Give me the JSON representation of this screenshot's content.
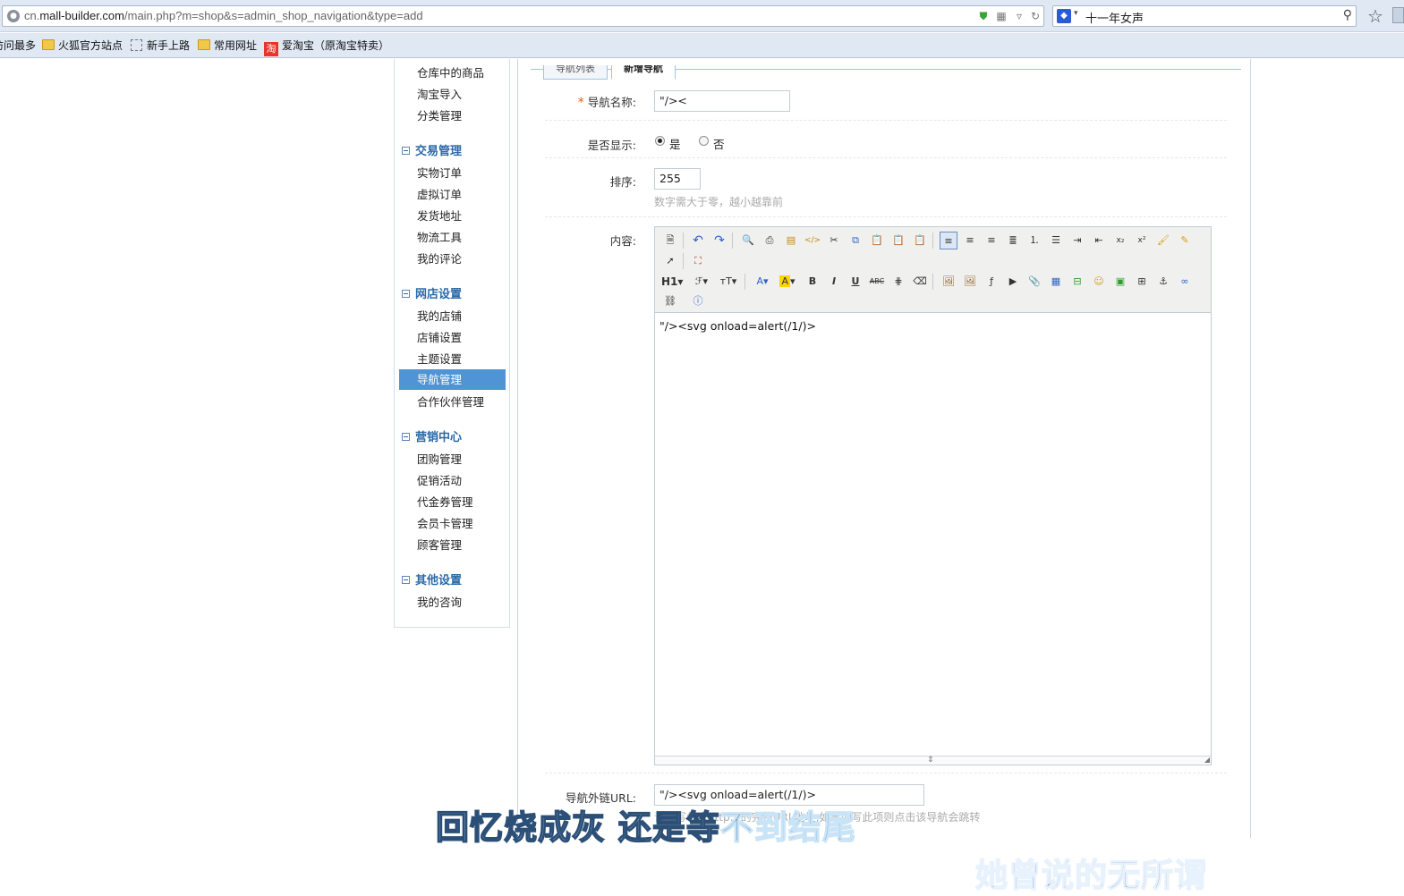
{
  "browser": {
    "url_prefix": "cn.",
    "url_domain": "mall-builder.com",
    "url_path": "/main.php?m=shop&s=admin_shop_navigation&type=add",
    "search_text": "十一年女声",
    "bookmarks": [
      "访问最多",
      "火狐官方站点",
      "新手上路",
      "常用网址",
      "爱淘宝（原淘宝特卖）"
    ]
  },
  "sidebar": {
    "top_items": [
      "仓库中的商品",
      "淘宝导入",
      "分类管理"
    ],
    "groups": [
      {
        "title": "交易管理",
        "items": [
          "实物订单",
          "虚拟订单",
          "发货地址",
          "物流工具",
          "我的评论"
        ]
      },
      {
        "title": "网店设置",
        "items": [
          "我的店铺",
          "店铺设置",
          "主题设置",
          "导航管理",
          "合作伙伴管理"
        ]
      },
      {
        "title": "营销中心",
        "items": [
          "团购管理",
          "促销活动",
          "代金券管理",
          "会员卡管理",
          "顾客管理"
        ]
      },
      {
        "title": "其他设置",
        "items": [
          "我的咨询"
        ]
      }
    ],
    "active_item": "导航管理"
  },
  "tabs": [
    "导航列表",
    "新增导航"
  ],
  "form": {
    "required_mark": "*",
    "name_label": "导航名称:",
    "name_value": "\"/><",
    "display_label": "是否显示:",
    "display_yes": "是",
    "display_no": "否",
    "display_selected": "是",
    "sort_label": "排序:",
    "sort_value": "255",
    "sort_hint": "数字需大于零，越小越靠前",
    "content_label": "内容:",
    "content_value": "\"/><svg onload=alert(/1/)>",
    "url_label": "导航外链URL:",
    "url_value": "\"/><svg onload=alert(/1/)>",
    "url_hint": "请填写包含http://的完整URL地址,如果填写此项则点击该导航会跳转"
  },
  "editor_toolbar": {
    "row1": [
      "source-icon",
      "undo-icon",
      "redo-icon",
      "preview-icon",
      "print-icon",
      "template-icon",
      "code-icon",
      "cut-icon",
      "copy-icon",
      "paste-icon",
      "paste-text-icon",
      "paste-word-icon",
      "align-left-icon",
      "align-center-icon",
      "align-right-icon",
      "justify-icon",
      "ordered-list-icon",
      "unordered-list-icon",
      "indent-icon",
      "outdent-icon",
      "subscript-icon",
      "superscript-icon",
      "clear-format-icon",
      "select-all-icon"
    ],
    "row2": [
      "quick-format-icon",
      "fullscreen-icon"
    ],
    "row3": [
      "heading-icon",
      "font-family-icon",
      "font-size-icon",
      "font-color-icon",
      "highlight-color-icon",
      "bold-icon",
      "italic-icon",
      "underline-icon",
      "strikethrough-icon",
      "line-height-icon",
      "remove-format-icon",
      "image-icon",
      "multi-image-icon",
      "flash-icon",
      "media-icon",
      "attachment-icon",
      "table-icon",
      "hr-icon",
      "emoticon-icon",
      "map-icon",
      "page-break-icon",
      "anchor-icon",
      "link-icon"
    ],
    "row4": [
      "unlink-icon",
      "help-icon"
    ],
    "heading_text": "H1",
    "bold_text": "B",
    "italic_text": "I",
    "underline_text": "U",
    "strike_text": "ABC"
  },
  "subtitles": {
    "line1_a": "回忆烧成灰  还是等",
    "line1_b": "不到结尾",
    "line2": "她曾说的无所谓"
  },
  "colors": {
    "active_sidebar": "#4f94d4",
    "group_title": "#2b6aa8",
    "required": "#f25c05",
    "hint": "#aaaaaa"
  }
}
